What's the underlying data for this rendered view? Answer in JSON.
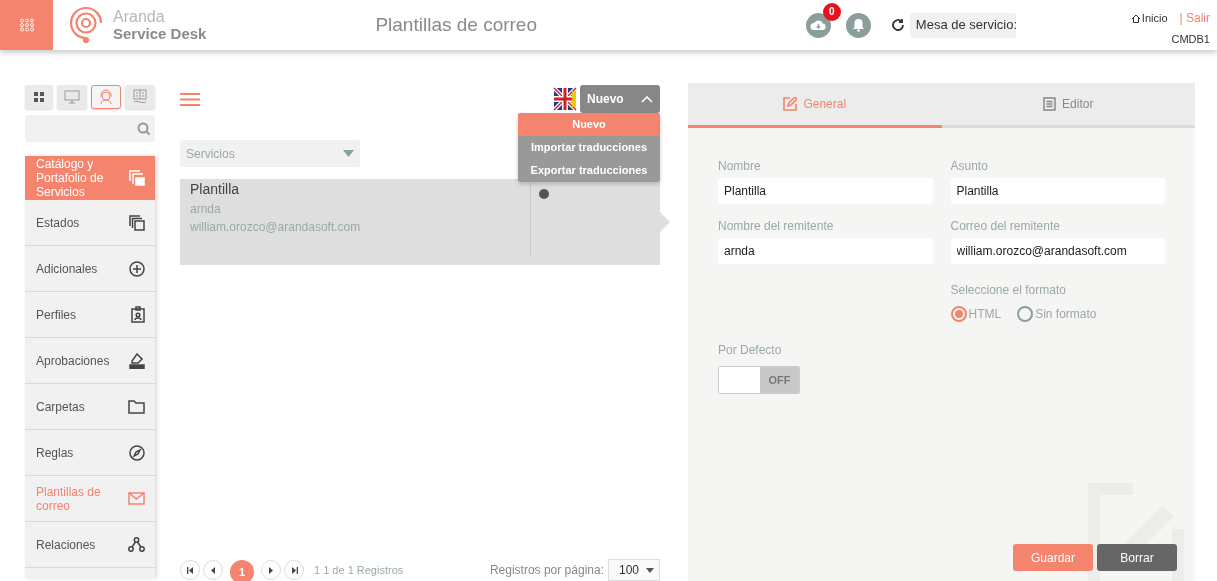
{
  "header": {
    "brand_top": "Aranda",
    "brand_bottom": "Service Desk",
    "title": "Plantillas de correo",
    "download_badge": "0",
    "desk_selector": "Mesa de servicio:",
    "home_link": "Inicio",
    "logout_link": "| Salir",
    "user": "CMDB1"
  },
  "view_tabs": [
    {
      "selected": false
    },
    {
      "selected": false
    },
    {
      "selected": true
    },
    {
      "selected": false
    }
  ],
  "sidebar": {
    "items": [
      {
        "label": "Catálogo y Portafolio de Servicios",
        "kind": "category",
        "selected": false
      },
      {
        "label": "Estados",
        "kind": "item",
        "selected": false
      },
      {
        "label": "Adicionales",
        "kind": "item",
        "selected": false
      },
      {
        "label": "Perfiles",
        "kind": "item",
        "selected": false
      },
      {
        "label": "Aprobaciones",
        "kind": "item",
        "selected": false
      },
      {
        "label": "Carpetas",
        "kind": "item",
        "selected": false
      },
      {
        "label": "Reglas",
        "kind": "item",
        "selected": false
      },
      {
        "label": "Plantillas de correo",
        "kind": "item",
        "selected": true
      },
      {
        "label": "Relaciones",
        "kind": "item",
        "selected": false
      }
    ]
  },
  "list": {
    "filter": "Servicios",
    "new_button": "Nuevo",
    "menu": [
      {
        "label": "Nuevo",
        "selected": true
      },
      {
        "label": "Importar traducciones",
        "selected": false
      },
      {
        "label": "Exportar traducciones",
        "selected": false
      }
    ],
    "records": [
      {
        "title": "Plantilla",
        "sender": "arnda",
        "email": "william.orozco@arandasoft.com",
        "selected": true
      }
    ],
    "pagination": {
      "current": "1",
      "summary": "1 1 de 1 Registros",
      "per_page_label": "Registros por página:",
      "per_page": "100"
    }
  },
  "editor": {
    "tabs": [
      {
        "label": "General",
        "selected": true
      },
      {
        "label": "Editor",
        "selected": false
      }
    ],
    "fields": [
      {
        "label": "Nombre",
        "value": "Plantilla"
      },
      {
        "label": "Asunto",
        "value": "Plantilla"
      },
      {
        "label": "Nombre del remitente",
        "value": "arnda"
      },
      {
        "label": "Correo del remitente",
        "value": "william.orozco@arandasoft.com"
      }
    ],
    "format_label": "Seleccione el formato",
    "formats": [
      {
        "label": "HTML",
        "selected": true
      },
      {
        "label": "Sin formato",
        "selected": false
      }
    ],
    "default_label": "Por Defecto",
    "default_on": false,
    "default_off_text": "OFF",
    "buttons": [
      {
        "label": "Guardar",
        "kind": "primary"
      },
      {
        "label": "Borrar",
        "kind": "secondary"
      }
    ]
  }
}
